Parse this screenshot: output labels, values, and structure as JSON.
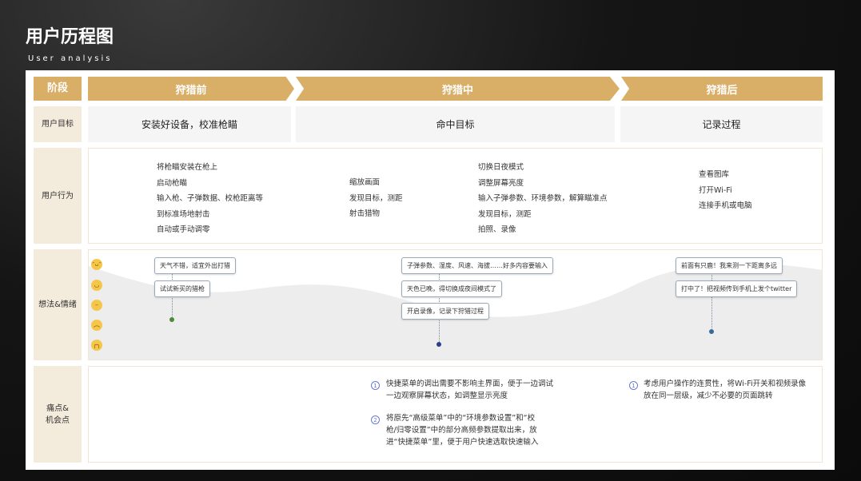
{
  "header": {
    "title": "用户历程图",
    "subtitle": "User analysis"
  },
  "colors": {
    "accent": "#d9ae66",
    "label_bg": "#f3ebdb"
  },
  "row_labels": {
    "stage": "阶段",
    "goal": "用户目标",
    "behavior": "用户行为",
    "emotion": "想法&情绪",
    "pain_line1": "痛点&",
    "pain_line2": "机会点"
  },
  "phases": [
    {
      "name": "狩猎前",
      "goal": "安装好设备，校准枪瞄"
    },
    {
      "name": "狩猎中",
      "goal": "命中目标"
    },
    {
      "name": "狩猎后",
      "goal": "记录过程"
    }
  ],
  "behaviors": {
    "before": [
      "将枪瞄安装在枪上",
      "启动枪瞄",
      "输入枪、子弹数据、校枪距离等",
      "到标准场地射击",
      "自动或手动调零"
    ],
    "during_a": [
      "缩放画面",
      "发现目标，测距",
      "射击猎物"
    ],
    "during_b": [
      "切换日夜模式",
      "调整屏幕亮度",
      "输入子弹参数、环境参数，解算瞄准点",
      "发现目标，测距",
      "拍照、录像"
    ],
    "after": [
      "查看图库",
      "打开Wi-Fi",
      "连接手机或电脑"
    ]
  },
  "emotion_faces": [
    "very-happy-face-icon",
    "happy-face-icon",
    "neutral-face-icon",
    "unhappy-face-icon",
    "sad-face-icon"
  ],
  "thoughts": {
    "before": [
      "天气不错，适宜外出打猎",
      "试试新买的猎枪"
    ],
    "during": [
      "子弹参数、湿度、风速、海拔……好多内容要输入",
      "天色已晚，得切换成夜间模式了",
      "开启录像，记录下狩猎过程"
    ],
    "after": [
      "前面有只鹿！我来测一下距离多远",
      "打中了！把视频传到手机上发个twitter"
    ]
  },
  "pain_points": {
    "during": [
      {
        "num": "1",
        "lines": [
          "快捷菜单的调出需要不影响主界面，便于一边调试",
          "一边观察屏幕状态，如调整显示亮度"
        ]
      },
      {
        "num": "2",
        "lines": [
          "将原先“高级菜单”中的“环境参数设置”和“校",
          "枪/归零设置”中的部分高频参数提取出来，放",
          "进“快捷菜单”里，便于用户快速选取快速输入"
        ]
      }
    ],
    "after": [
      {
        "num": "1",
        "lines": [
          "考虑用户操作的连贯性，将Wi-Fi开关和视频录像",
          "放在同一层级，减少不必要的页面跳转"
        ]
      }
    ]
  }
}
